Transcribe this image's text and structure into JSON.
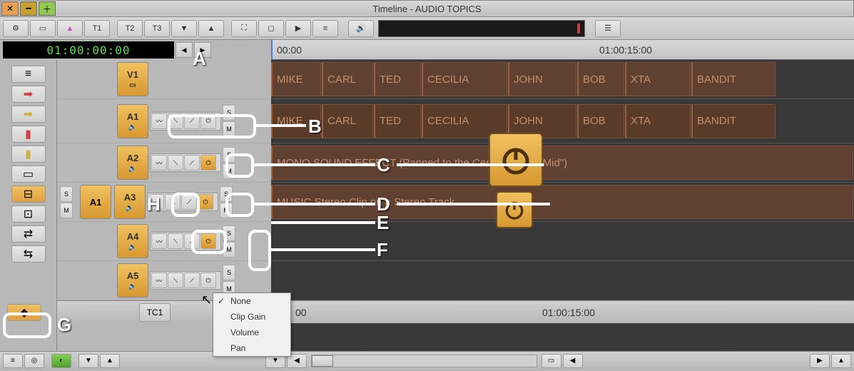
{
  "window": {
    "title": "Timeline - AUDIO TOPICS"
  },
  "toolbar": {
    "t1": "T1",
    "t2": "T2",
    "t3": "T3"
  },
  "timecode": "01:00:00:00",
  "ruler": {
    "start": "00:00",
    "label": "01:00:15:00"
  },
  "tracks": {
    "v1": "V1",
    "a1": "A1",
    "a2": "A2",
    "a3": "A3",
    "a4": "A4",
    "a5": "A5",
    "src_a1": "A1",
    "tc1": "TC1"
  },
  "sm": {
    "s": "S",
    "m": "M"
  },
  "clips": {
    "v1": [
      "MIKE",
      "CARL",
      "TED",
      "CECILIA",
      "JOHN",
      "BOB",
      "XTA",
      "BANDIT"
    ],
    "a1": [
      "MIKE",
      "CARL",
      "TED",
      "CECILIA",
      "JOHN",
      "BOB",
      "XTA",
      "BANDIT"
    ],
    "a2": "MONO SOUND EFFECT (Panned to the Center, a.k.a. \"Mid\")",
    "a3": "MUSIC Stereo Clip on a Stereo Track"
  },
  "tc_ruler": {
    "mid": "00",
    "right": "01:00:15:00"
  },
  "context_menu": {
    "items": [
      "None",
      "Clip Gain",
      "Volume",
      "Pan"
    ],
    "checked_index": 0
  },
  "annotations": {
    "a": "A",
    "b": "B",
    "c": "C",
    "d": "D",
    "e": "E",
    "f": "F",
    "g": "G",
    "h": "H"
  }
}
